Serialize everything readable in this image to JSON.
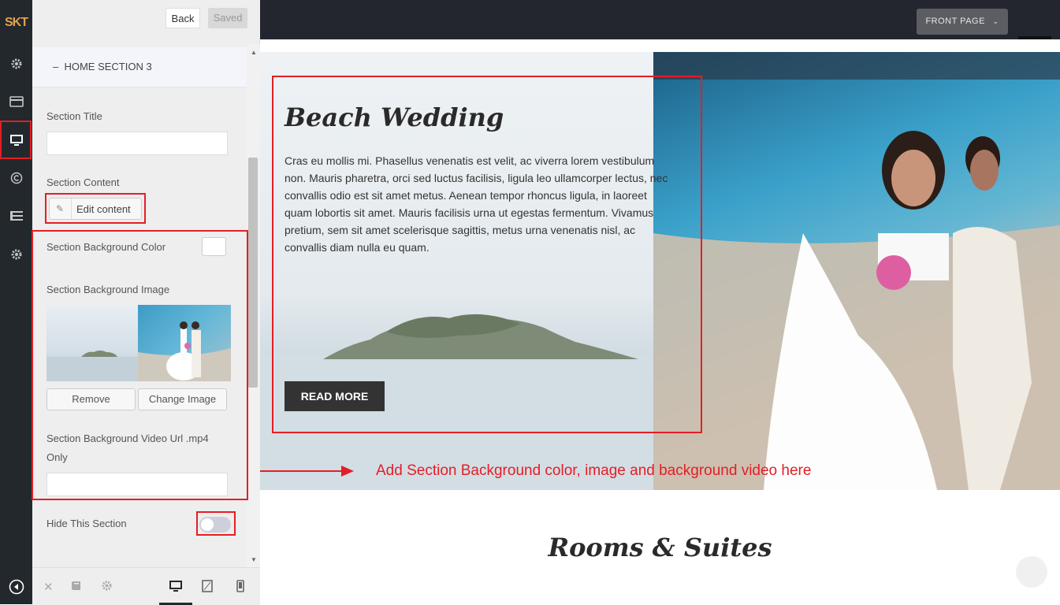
{
  "rail": {
    "logo": "SKT",
    "icons": [
      "gear-icon",
      "card-icon",
      "desktop-icon",
      "copyright-icon",
      "list-icon",
      "gear-icon",
      "collapse-icon"
    ]
  },
  "panel": {
    "back_label": "Back",
    "saved_label": "Saved",
    "section_header": "HOME SECTION 3",
    "section_title_label": "Section Title",
    "section_title_value": "",
    "section_content_label": "Section Content",
    "edit_content_label": "Edit content",
    "bg_color_label": "Section Background Color",
    "bg_color_value": "#ffffff",
    "bg_image_label": "Section Background Image",
    "remove_label": "Remove",
    "change_image_label": "Change Image",
    "bg_video_label_line1": "Section Background Video Url .mp4",
    "bg_video_label_line2": "Only",
    "bg_video_value": "",
    "hide_section_label": "Hide This Section",
    "hide_section_on": false
  },
  "footer": {
    "icons": [
      "close-icon",
      "book-icon",
      "gear-icon"
    ],
    "devices": [
      "desktop-icon",
      "tablet-icon",
      "mobile-icon"
    ],
    "active_device": "desktop"
  },
  "preview": {
    "front_page_label": "FRONT PAGE",
    "heading": "Beach Wedding",
    "paragraph": "Cras eu mollis mi. Phasellus venenatis est velit, ac viverra lorem vestibulum non. Mauris pharetra, orci sed luctus facilisis, ligula leo ullamcorper lectus, nec convallis odio est sit amet metus. Aenean tempor rhoncus ligula, in laoreet quam lobortis sit amet. Mauris facilisis urna ut egestas fermentum. Vivamus pretium, sem sit amet scelerisque sagittis, metus urna venenatis nisl, ac convallis diam nulla eu quam.",
    "read_more_label": "READ MORE",
    "annotation": "Add Section Background color, image and background video here",
    "rooms_heading": "Rooms & Suites"
  },
  "colors": {
    "highlight": "#e41e25",
    "rail_bg": "#23282d",
    "header_bg": "#23262f"
  }
}
